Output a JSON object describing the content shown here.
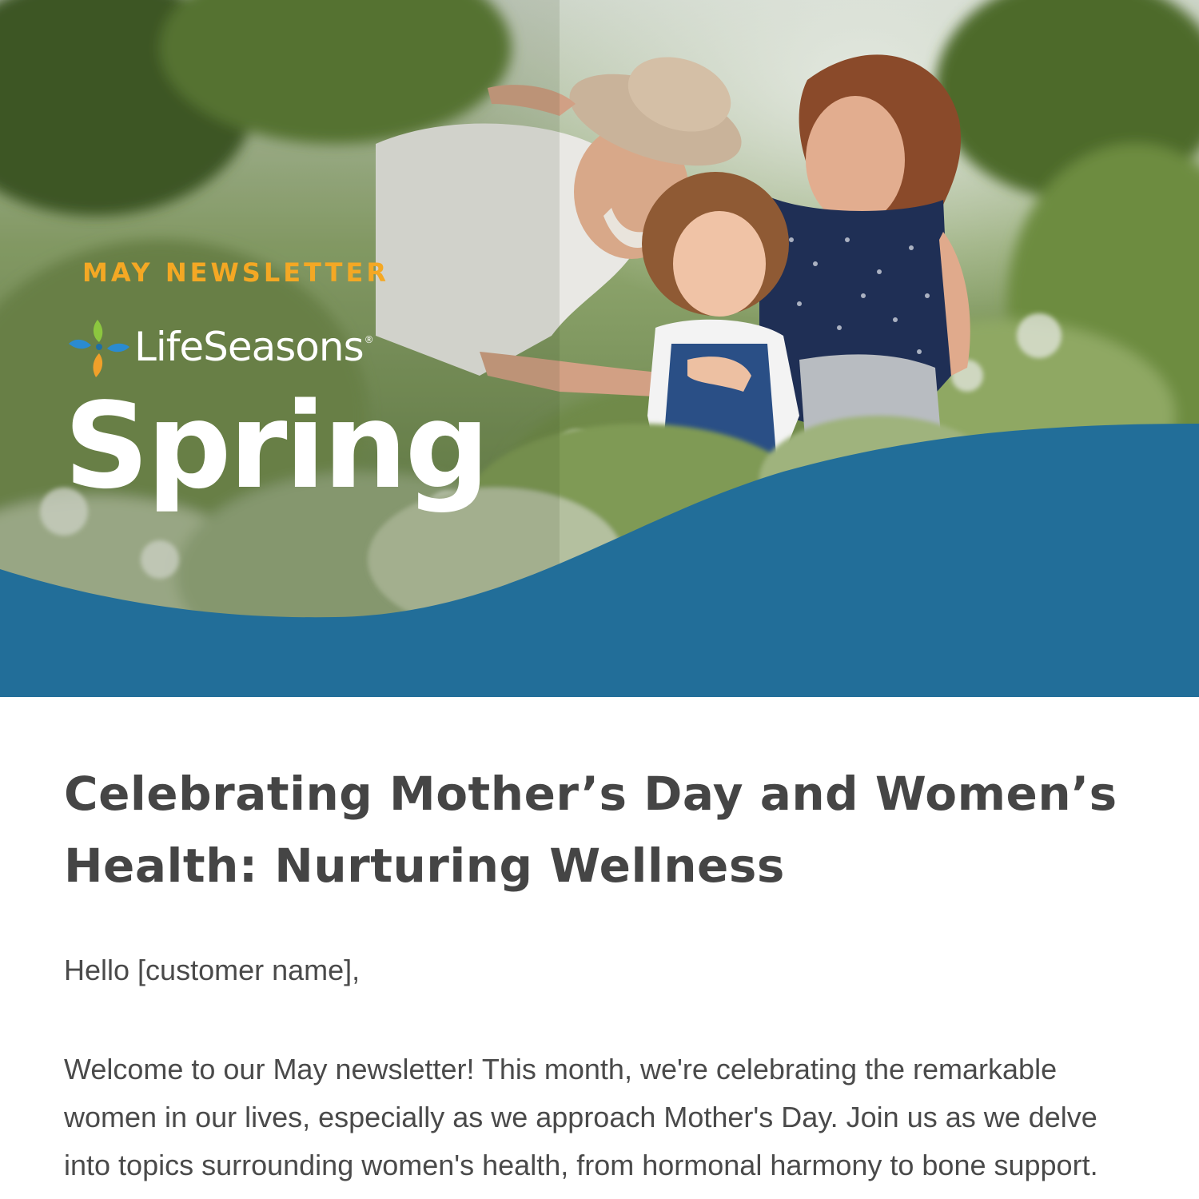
{
  "hero": {
    "eyebrow": "MAY NEWSLETTER",
    "brand_name": "LifeSeasons",
    "brand_reg": "®",
    "season": "Spring",
    "photo_description_icon": "family-garden-photo",
    "colors": {
      "eyebrow": "#f4a824",
      "wave": "#226e99",
      "text": "#ffffff"
    }
  },
  "article": {
    "headline": "Celebrating Mother’s Day and Women’s Health: Nurturing Wellness",
    "greeting": "Hello [customer name],",
    "intro": "Welcome to our May newsletter! This month, we're celebrating the remarkable women in our lives, especially as we approach Mother's Day. Join us as we delve into topics surrounding women's health, from hormonal harmony to bone support. Let's dive in!"
  }
}
